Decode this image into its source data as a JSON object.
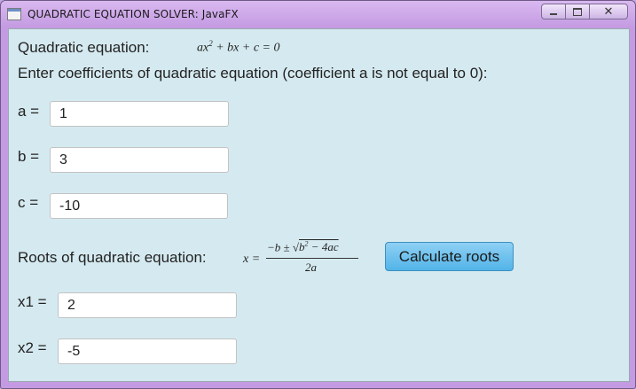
{
  "window": {
    "title": "QUADRATIC EQUATION SOLVER: JavaFX",
    "min_icon": "minimize-icon",
    "max_icon": "maximize-icon",
    "close_icon": "close-icon"
  },
  "equation": {
    "label": "Quadratic equation:",
    "formula_parts": {
      "a": "ax",
      "exp": "2",
      "rest": " + bx + c = 0"
    }
  },
  "instruction": "Enter coefficients of quadratic equation (coefficient a is not equal to 0):",
  "coefficients": {
    "a": {
      "label": "a =",
      "value": "1"
    },
    "b": {
      "label": "b =",
      "value": "3"
    },
    "c": {
      "label": "c =",
      "value": "-10"
    }
  },
  "roots": {
    "label": "Roots of quadratic equation:",
    "formula": {
      "lhs": "x =",
      "num_prefix": "−b ± √",
      "radicand_base": "b",
      "radicand_exp": "2",
      "radicand_rest": " − 4ac",
      "den": "2a"
    },
    "calculate_button": "Calculate roots",
    "x1": {
      "label": "x1 =",
      "value": "2"
    },
    "x2": {
      "label": "x2 =",
      "value": "-5"
    }
  }
}
